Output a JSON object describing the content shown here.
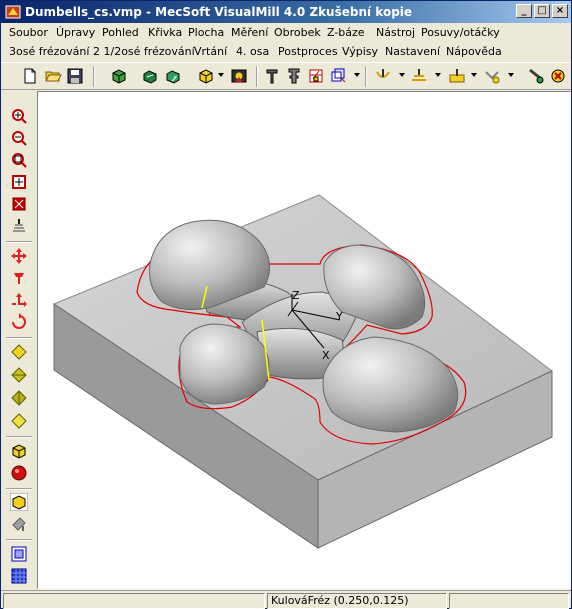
{
  "window": {
    "title": "Dumbells_cs.vmp - MecSoft  VisualMill 4.0 Zkušební kopie",
    "minimize_glyph": "_",
    "maximize_glyph": "□",
    "close_glyph": "×"
  },
  "menu_row1": [
    "Soubor",
    "Úpravy",
    "Pohled",
    "Křivka",
    "Plocha",
    "Měření",
    "Obrobek",
    "Z-báze",
    "Nástroj",
    "Posuvy/otáčky"
  ],
  "menu_row2": [
    "3osé frézování",
    "2 1/2osé frézování",
    "Vrtání",
    "4. osa",
    "Postproces",
    "Výpisy",
    "Nastavení",
    "Nápověda"
  ],
  "toolbar_icons": [
    "new-file-icon",
    "open-folder-icon",
    "save-disk-icon",
    "stock-icon",
    "part-icon",
    "csys-icon",
    "box-icon",
    "image-icon",
    "tool-icon",
    "tool-holder-icon",
    "machining-icon",
    "cube-icon",
    "toolpath-icon",
    "zlevel-icon",
    "pocket-icon",
    "drill-icon",
    "simulate-icon",
    "stop-icon"
  ],
  "left_tools": [
    "zoom-in-icon",
    "zoom-out-icon",
    "zoom-window-icon",
    "zoom-extents-icon",
    "fit-icon",
    "level-icon",
    "pan-icon",
    "move-up-icon",
    "rotate-icon",
    "spin-icon",
    "view-top-icon",
    "view-front-icon",
    "view-iso-icon",
    "view-right-icon",
    "shade-icon",
    "sphere-icon",
    "wireframe-icon",
    "paint-icon",
    "grid-icon",
    "layer-icon"
  ],
  "viewport": {
    "axis_labels": {
      "z": "Z",
      "y": "Y",
      "x": "X"
    }
  },
  "status": {
    "tool": "KulováFréz (0.250,0.125)"
  },
  "colors": {
    "titlebar": "#0a246a",
    "window_bg": "#ece9d8",
    "viewport_bg": "#ffffff",
    "model_top": "#c8c8c8",
    "model_front": "#9a9a9a",
    "model_side": "#b4b4b4",
    "toolpath": "#ff0000",
    "highlight": "#ffff00"
  }
}
